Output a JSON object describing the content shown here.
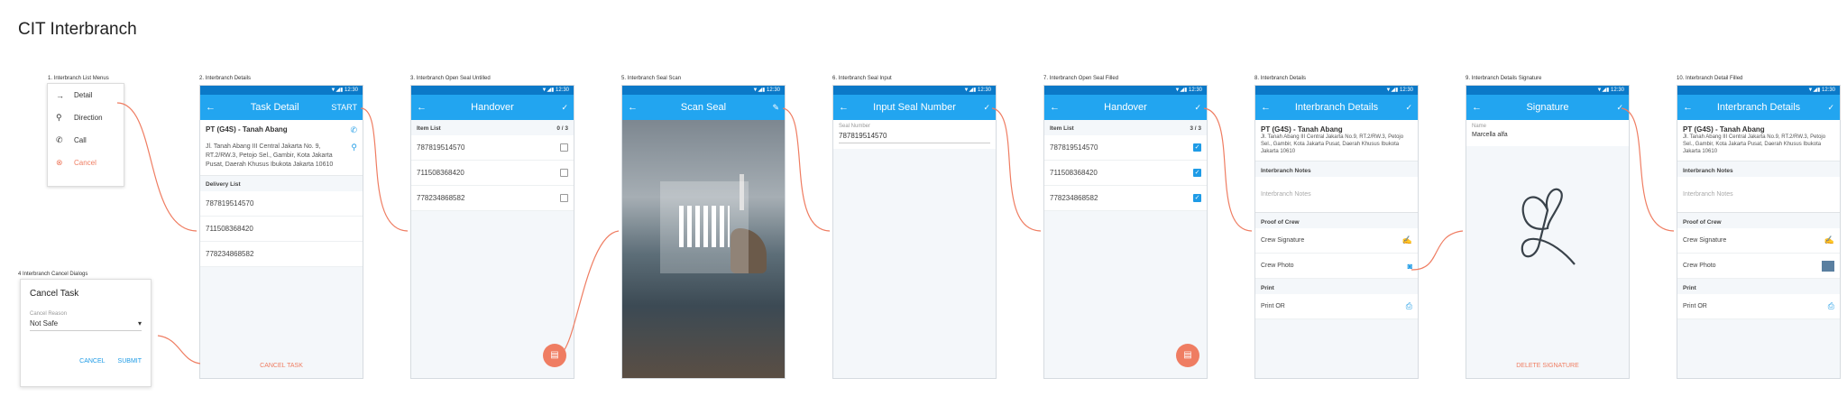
{
  "doc_title": "CIT Interbranch",
  "captions": [
    "1. Interbranch List Menus",
    "2. Interbranch Details",
    "3. Interbranch Open Seal Untilled",
    "5. Interbranch Seal Scan",
    "6. Interbranch Seal Input",
    "7. Interbranch Open Seal Filled",
    "8. Interbranch Details",
    "9. Interbranch Details Signature",
    "10. Interbranch Detail Filled",
    "4 Interbranch Cancel Dialogs"
  ],
  "status_time": "12:30",
  "menu": {
    "items": [
      {
        "icon": "→",
        "label": "Detail"
      },
      {
        "icon": "⚲",
        "label": "Direction"
      },
      {
        "icon": "✆",
        "label": "Call"
      },
      {
        "icon": "⊗",
        "label": "Cancel"
      }
    ]
  },
  "task_detail": {
    "title": "Task Detail",
    "action": "START",
    "name": "PT (G4S) - Tanah Abang",
    "address": "Jl. Tanah Abang III Central Jakarta No. 9, RT.2/RW.3, Petojo Sel., Gambir, Kota Jakarta Pusat, Daerah Khusus Ibukota Jakarta 10610",
    "delivery_header": "Delivery List",
    "items": [
      "787819514570",
      "711508368420",
      "778234868582"
    ],
    "cancel": "CANCEL TASK"
  },
  "handover1": {
    "title": "Handover",
    "header": "Item List",
    "count": "0 / 3",
    "items": [
      "787819514570",
      "711508368420",
      "778234868582"
    ]
  },
  "scan": {
    "title": "Scan Seal"
  },
  "input_seal": {
    "title": "Input Seal Number",
    "label": "Seal Number",
    "value": "787819514570"
  },
  "handover2": {
    "title": "Handover",
    "header": "Item List",
    "count": "3 / 3",
    "items": [
      "787819514570",
      "711508368420",
      "778234868582"
    ]
  },
  "details1": {
    "title": "Interbranch Details",
    "name": "PT (G4S) - Tanah Abang",
    "address": "Jl. Tanah Abang III Central Jakarta No.9, RT.2/RW.3, Petojo Sel., Gambir, Kota Jakarta Pusat, Daerah Khusus Ibukota Jakarta 10610",
    "notes_header": "Interbranch Notes",
    "notes_placeholder": "Interbranch Notes",
    "proof_header": "Proof of Crew",
    "crew_signature": "Crew Signature",
    "crew_photo": "Crew Photo",
    "print_header": "Print",
    "print_or": "Print OR"
  },
  "signature": {
    "title": "Signature",
    "label": "Name",
    "value": "Marcella alfa",
    "delete": "DELETE SIGNATURE"
  },
  "details2": {
    "title": "Interbranch Details",
    "name": "PT (G4S) - Tanah Abang",
    "address": "Jl. Tanah Abang III Central Jakarta No.9, RT.2/RW.3, Petojo Sel., Gambir, Kota Jakarta Pusat, Daerah Khusus Ibukota Jakarta 10610",
    "notes_header": "Interbranch Notes",
    "notes_placeholder": "Interbranch Notes",
    "proof_header": "Proof of Crew",
    "crew_signature": "Crew Signature",
    "crew_photo": "Crew Photo",
    "print_header": "Print",
    "print_or": "Print OR"
  },
  "cancel_dialog": {
    "title": "Cancel Task",
    "label": "Cancel Reason",
    "value": "Not Safe",
    "cancel": "CANCEL",
    "submit": "SUBMIT"
  },
  "colors": {
    "primary": "#22a5f0",
    "status": "#0b79c8",
    "accent": "#ef7d62"
  }
}
